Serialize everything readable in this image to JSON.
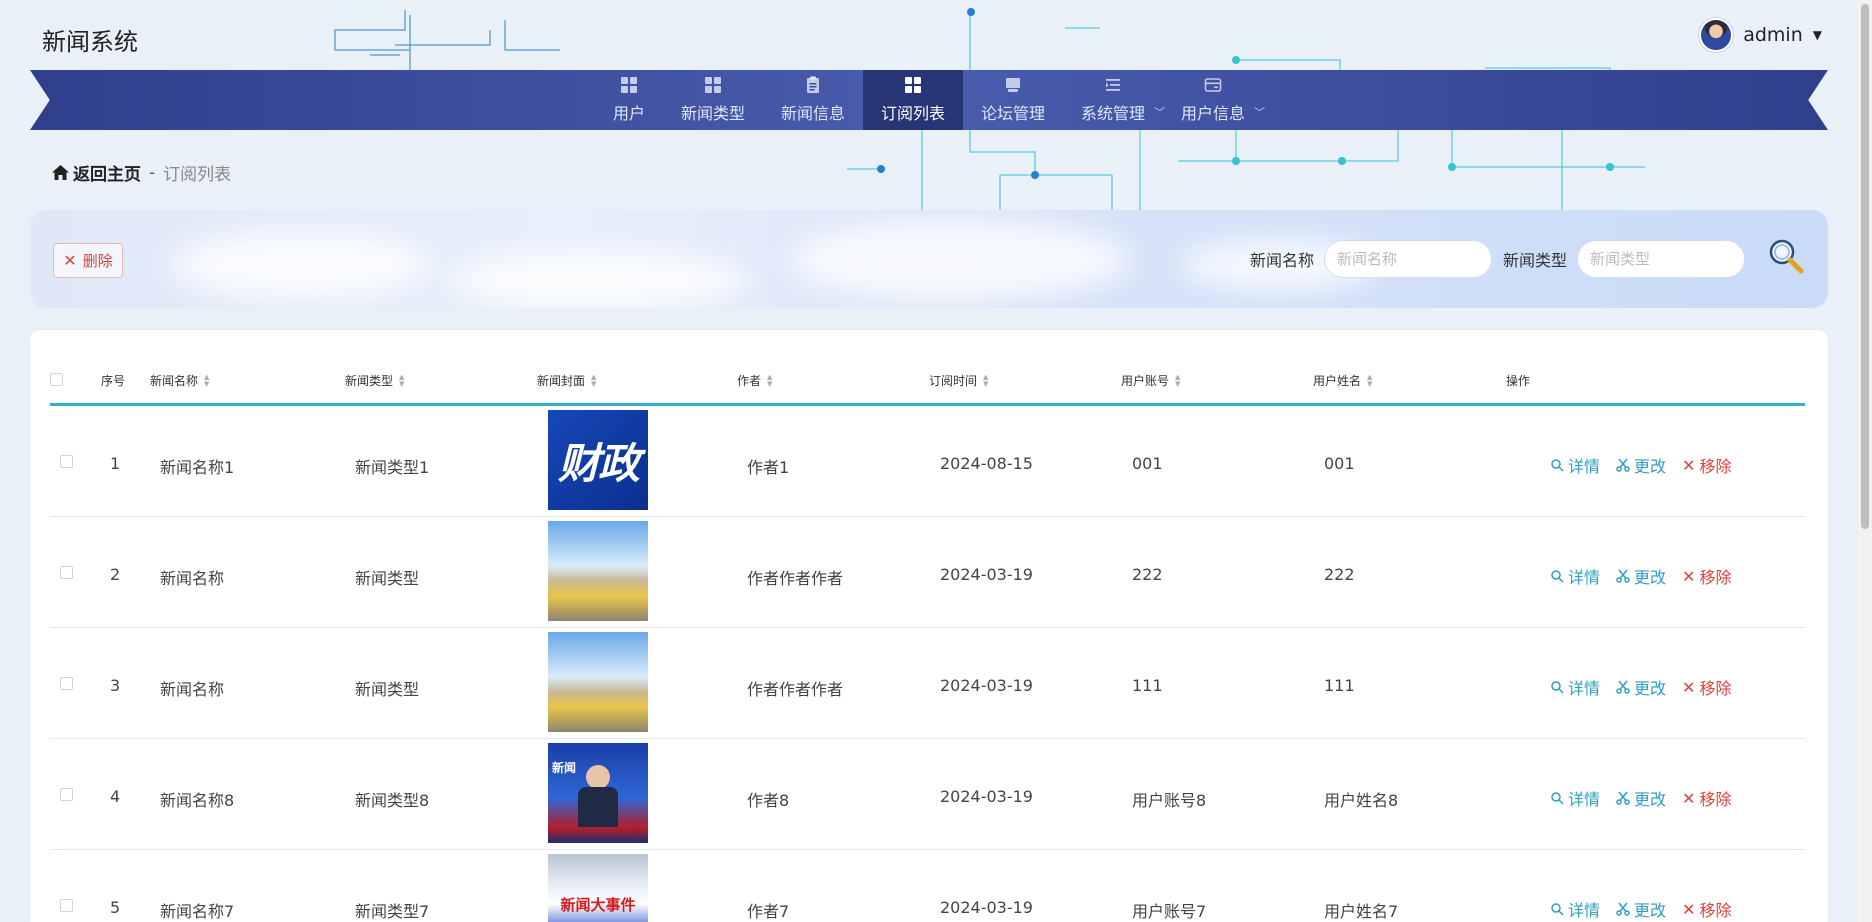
{
  "app": {
    "title": "新闻系统"
  },
  "user": {
    "name": "admin"
  },
  "nav": {
    "items": [
      {
        "label": "用户",
        "icon": "grid-icon"
      },
      {
        "label": "新闻类型",
        "icon": "grid-icon"
      },
      {
        "label": "新闻信息",
        "icon": "clipboard-icon"
      },
      {
        "label": "订阅列表",
        "icon": "grid-icon",
        "active": true
      },
      {
        "label": "论坛管理",
        "icon": "monitor-icon"
      },
      {
        "label": "系统管理",
        "icon": "list-icon",
        "has_submenu": true
      },
      {
        "label": "用户信息",
        "icon": "card-icon",
        "has_submenu": true
      }
    ]
  },
  "breadcrumb": {
    "home": "返回主页",
    "separator": "-",
    "current": "订阅列表"
  },
  "search": {
    "delete_label": "删除",
    "news_name_label": "新闻名称",
    "news_name_placeholder": "新闻名称",
    "news_type_label": "新闻类型",
    "news_type_placeholder": "新闻类型"
  },
  "table": {
    "headers": {
      "index": "序号",
      "news_name": "新闻名称",
      "news_type": "新闻类型",
      "cover": "新闻封面",
      "author": "作者",
      "time": "订阅时间",
      "account": "用户账号",
      "user_name": "用户姓名",
      "ops": "操作"
    },
    "actions": {
      "detail": "详情",
      "edit": "更改",
      "remove": "移除"
    },
    "rows": [
      {
        "index": "1",
        "news_name": "新闻名称1",
        "news_type": "新闻类型1",
        "cover_text": "财政",
        "author": "作者1",
        "time": "2024-08-15",
        "account": "001",
        "user_name": "001"
      },
      {
        "index": "2",
        "news_name": "新闻名称",
        "news_type": "新闻类型",
        "cover_text": "",
        "author": "作者作者作者",
        "time": "2024-03-19",
        "account": "222",
        "user_name": "222"
      },
      {
        "index": "3",
        "news_name": "新闻名称",
        "news_type": "新闻类型",
        "cover_text": "",
        "author": "作者作者作者",
        "time": "2024-03-19",
        "account": "111",
        "user_name": "111"
      },
      {
        "index": "4",
        "news_name": "新闻名称8",
        "news_type": "新闻类型8",
        "cover_text": "新闻",
        "author": "作者8",
        "time": "2024-03-19",
        "account": "用户账号8",
        "user_name": "用户姓名8"
      },
      {
        "index": "5",
        "news_name": "新闻名称7",
        "news_type": "新闻类型7",
        "cover_text": "新闻大事件",
        "author": "作者7",
        "time": "2024-03-19",
        "account": "用户账号7",
        "user_name": "用户姓名7"
      }
    ]
  },
  "colors": {
    "nav_bg": "#3b4a9c",
    "nav_active": "#273575",
    "accent": "#36b0c6",
    "danger": "#d9433d",
    "link": "#2e9fc1"
  }
}
